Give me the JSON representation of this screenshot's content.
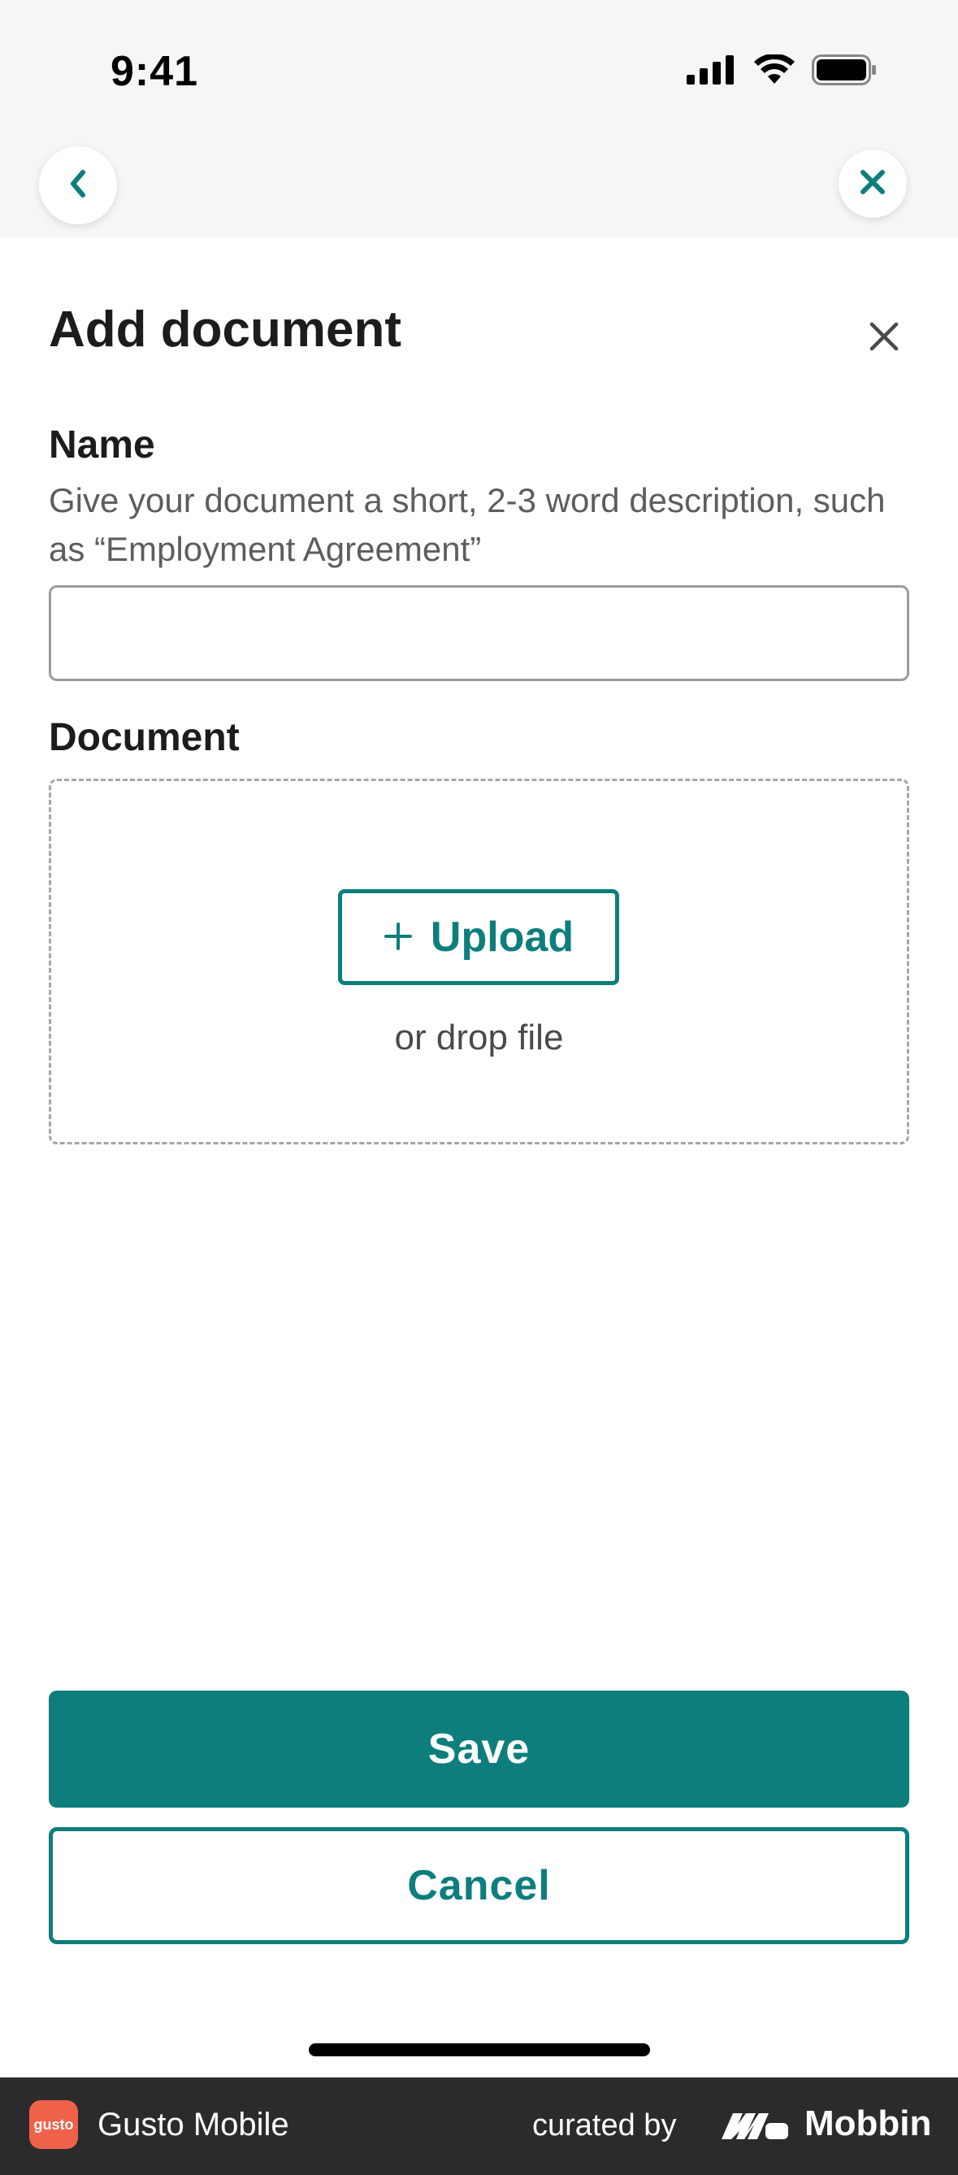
{
  "status_bar": {
    "time": "9:41",
    "icons": [
      "signal-icon",
      "wifi-icon",
      "battery-icon"
    ]
  },
  "nav": {
    "back_icon": "chevron-left-icon",
    "close_icon": "close-icon",
    "accent": "#0d7e7c"
  },
  "sheet": {
    "title": "Add document",
    "close_icon": "close-icon"
  },
  "form": {
    "name_label": "Name",
    "name_helper": "Give your document a short, 2-3 word description, such as “Employment Agreement”",
    "name_value": "",
    "document_label": "Document",
    "upload_label": "Upload",
    "upload_icon": "plus-icon",
    "drop_text": "or drop file"
  },
  "actions": {
    "save_label": "Save",
    "cancel_label": "Cancel"
  },
  "footer": {
    "app_logo_text": "gusto",
    "app_name": "Gusto Mobile",
    "curated_by": "curated by",
    "brand": "Mobbin"
  },
  "colors": {
    "primary": "#0d7e7c",
    "footer_bg": "#2b2b2d",
    "logo_bg": "#f0614a"
  }
}
